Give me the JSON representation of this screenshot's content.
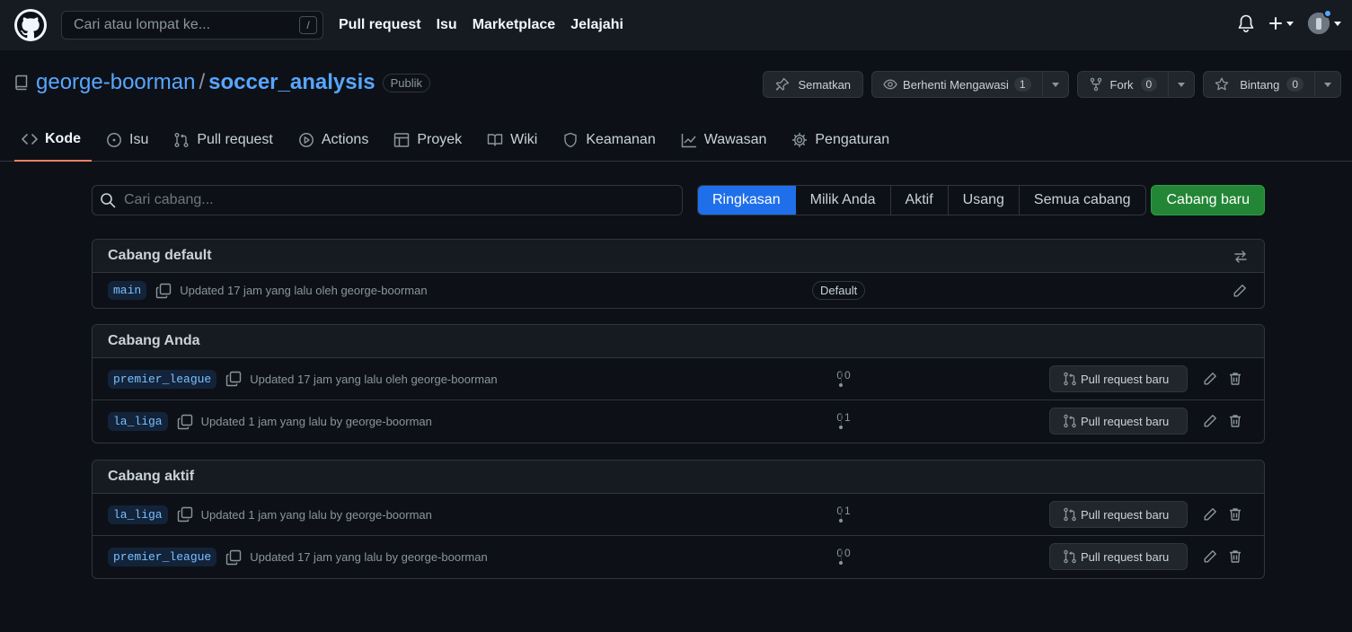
{
  "header": {
    "search_placeholder": "Cari atau lompat ke...",
    "search_shortcut": "/",
    "nav": [
      "Pull request",
      "Isu",
      "Marketplace",
      "Jelajahi"
    ]
  },
  "repo": {
    "owner": "george-boorman",
    "separator": "/",
    "name": "soccer_analysis",
    "visibility": "Publik",
    "actions": {
      "pin_label": "Sematkan",
      "watch_label": "Berhenti Mengawasi",
      "watch_count": "1",
      "fork_label": "Fork",
      "fork_count": "0",
      "star_label": "Bintang",
      "star_count": "0"
    }
  },
  "tabs": [
    {
      "label": "Kode",
      "icon": "code-icon",
      "active": true
    },
    {
      "label": "Isu",
      "icon": "issue-icon"
    },
    {
      "label": "Pull request",
      "icon": "pull-request-icon"
    },
    {
      "label": "Actions",
      "icon": "play-icon"
    },
    {
      "label": "Proyek",
      "icon": "table-icon"
    },
    {
      "label": "Wiki",
      "icon": "book-icon"
    },
    {
      "label": "Keamanan",
      "icon": "shield-icon"
    },
    {
      "label": "Wawasan",
      "icon": "graph-icon"
    },
    {
      "label": "Pengaturan",
      "icon": "gear-icon"
    }
  ],
  "filter": {
    "search_placeholder": "Cari cabang...",
    "segments": [
      "Ringkasan",
      "Milik Anda",
      "Aktif",
      "Usang",
      "Semua cabang"
    ],
    "selected_segment": "Ringkasan",
    "new_branch_label": "Cabang baru"
  },
  "default_section": {
    "title": "Cabang default",
    "branch": "main",
    "updated": "Updated 17 jam yang lalu oleh george-boorman",
    "badge": "Default"
  },
  "yours_section": {
    "title": "Cabang Anda",
    "rows": [
      {
        "branch": "premier_league",
        "updated": "Updated 17 jam yang lalu oleh george-boorman",
        "behind": "0",
        "ahead": "0",
        "pr_label": "Pull request baru"
      },
      {
        "branch": "la_liga",
        "updated": "Updated 1 jam yang lalu by george-boorman",
        "behind": "0",
        "ahead": "1",
        "pr_label": "Pull request baru"
      }
    ]
  },
  "active_section": {
    "title": "Cabang aktif",
    "rows": [
      {
        "branch": "la_liga",
        "updated": "Updated 1 jam yang lalu by george-boorman",
        "behind": "0",
        "ahead": "1",
        "pr_label": "Pull request baru"
      },
      {
        "branch": "premier_league",
        "updated": "Updated 17 jam yang lalu by george-boorman",
        "behind": "0",
        "ahead": "0",
        "pr_label": "Pull request baru"
      }
    ]
  },
  "colors": {
    "background": "#0d1117",
    "header": "#161b22",
    "accent": "#58a6ff",
    "primary_button": "#238636",
    "selected_segment": "#1f6feb",
    "active_tab_underline": "#f78166"
  }
}
